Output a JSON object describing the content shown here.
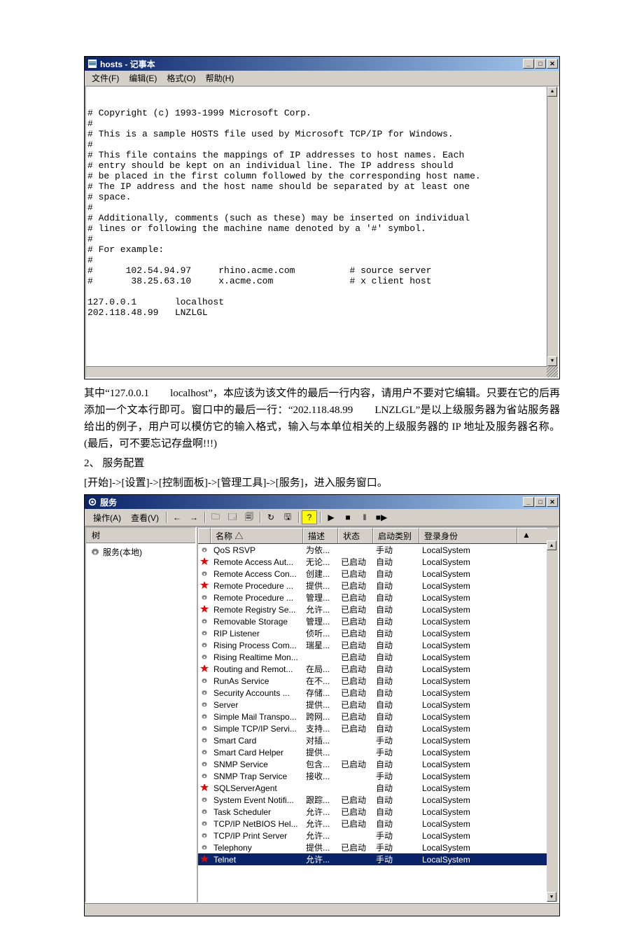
{
  "notepad": {
    "title": "hosts - 记事本",
    "menus": {
      "file": "文件(F)",
      "edit": "编辑(E)",
      "format": "格式(O)",
      "help": "帮助(H)"
    },
    "text": "# Copyright (c) 1993-1999 Microsoft Corp.\n#\n# This is a sample HOSTS file used by Microsoft TCP/IP for Windows.\n#\n# This file contains the mappings of IP addresses to host names. Each\n# entry should be kept on an individual line. The IP address should\n# be placed in the first column followed by the corresponding host name.\n# The IP address and the host name should be separated by at least one\n# space.\n#\n# Additionally, comments (such as these) may be inserted on individual\n# lines or following the machine name denoted by a '#' symbol.\n#\n# For example:\n#\n#      102.54.94.97     rhino.acme.com          # source server\n#       38.25.63.10     x.acme.com              # x client host\n\n127.0.0.1       localhost\n202.118.48.99   LNZLGL\n"
  },
  "explain": {
    "p1": "其中“127.0.0.1　　localhost”，本应该为该文件的最后一行内容，请用户不要对它编辑。只要在它的后再添加一个文本行即可。窗口中的最后一行：“202.118.48.99　　LNZLGL”是以上级服务器为省站服务器给出的例子，用户可以模仿它的输入格式，输入与本单位相关的上级服务器的 IP 地址及服务器名称。(最后，可不要忘记存盘啊!!!)",
    "p2": "2、 服务配置",
    "p3": "[开始]->[设置]->[控制面板]->[管理工具]->[服务]，进入服务窗口。"
  },
  "services": {
    "title": "服务",
    "toolbar": {
      "action": "操作(A)",
      "view": "查看(V)"
    },
    "tree_tab": "树",
    "tree_node": "服务(本地)",
    "headers": {
      "name": "名称  △",
      "desc": "描述",
      "status": "状态",
      "type": "启动类别",
      "logon": "登录身份"
    },
    "rows": [
      {
        "star": false,
        "name": "QoS RSVP",
        "desc": "为依...",
        "status": "",
        "type": "手动",
        "logon": "LocalSystem",
        "sel": false
      },
      {
        "star": true,
        "name": "Remote Access Aut...",
        "desc": "无论...",
        "status": "已启动",
        "type": "自动",
        "logon": "LocalSystem",
        "sel": false
      },
      {
        "star": false,
        "name": "Remote Access Con...",
        "desc": "创建...",
        "status": "已启动",
        "type": "自动",
        "logon": "LocalSystem",
        "sel": false
      },
      {
        "star": true,
        "name": "Remote Procedure ...",
        "desc": "提供...",
        "status": "已启动",
        "type": "自动",
        "logon": "LocalSystem",
        "sel": false
      },
      {
        "star": false,
        "name": "Remote Procedure ...",
        "desc": "管理...",
        "status": "已启动",
        "type": "自动",
        "logon": "LocalSystem",
        "sel": false
      },
      {
        "star": true,
        "name": "Remote Registry Se...",
        "desc": "允许...",
        "status": "已启动",
        "type": "自动",
        "logon": "LocalSystem",
        "sel": false
      },
      {
        "star": false,
        "name": "Removable Storage",
        "desc": "管理...",
        "status": "已启动",
        "type": "自动",
        "logon": "LocalSystem",
        "sel": false
      },
      {
        "star": false,
        "name": "RIP Listener",
        "desc": "侦听...",
        "status": "已启动",
        "type": "自动",
        "logon": "LocalSystem",
        "sel": false
      },
      {
        "star": false,
        "name": "Rising Process Com...",
        "desc": "瑞星...",
        "status": "已启动",
        "type": "自动",
        "logon": "LocalSystem",
        "sel": false
      },
      {
        "star": false,
        "name": "Rising Realtime Mon...",
        "desc": "",
        "status": "已启动",
        "type": "自动",
        "logon": "LocalSystem",
        "sel": false
      },
      {
        "star": true,
        "name": "Routing and Remot...",
        "desc": "在局...",
        "status": "已启动",
        "type": "自动",
        "logon": "LocalSystem",
        "sel": false
      },
      {
        "star": false,
        "name": "RunAs Service",
        "desc": "在不...",
        "status": "已启动",
        "type": "自动",
        "logon": "LocalSystem",
        "sel": false
      },
      {
        "star": false,
        "name": "Security Accounts ...",
        "desc": "存储...",
        "status": "已启动",
        "type": "自动",
        "logon": "LocalSystem",
        "sel": false
      },
      {
        "star": false,
        "name": "Server",
        "desc": "提供...",
        "status": "已启动",
        "type": "自动",
        "logon": "LocalSystem",
        "sel": false
      },
      {
        "star": false,
        "name": "Simple Mail Transpo...",
        "desc": "跨网...",
        "status": "已启动",
        "type": "自动",
        "logon": "LocalSystem",
        "sel": false
      },
      {
        "star": false,
        "name": "Simple TCP/IP Servi...",
        "desc": "支持...",
        "status": "已启动",
        "type": "自动",
        "logon": "LocalSystem",
        "sel": false
      },
      {
        "star": false,
        "name": "Smart Card",
        "desc": "对插...",
        "status": "",
        "type": "手动",
        "logon": "LocalSystem",
        "sel": false
      },
      {
        "star": false,
        "name": "Smart Card Helper",
        "desc": "提供...",
        "status": "",
        "type": "手动",
        "logon": "LocalSystem",
        "sel": false
      },
      {
        "star": false,
        "name": "SNMP Service",
        "desc": "包含...",
        "status": "已启动",
        "type": "自动",
        "logon": "LocalSystem",
        "sel": false
      },
      {
        "star": false,
        "name": "SNMP Trap Service",
        "desc": "接收...",
        "status": "",
        "type": "手动",
        "logon": "LocalSystem",
        "sel": false
      },
      {
        "star": true,
        "name": "SQLServerAgent",
        "desc": "",
        "status": "",
        "type": "自动",
        "logon": "LocalSystem",
        "sel": false
      },
      {
        "star": false,
        "name": "System Event Notifi...",
        "desc": "跟踪...",
        "status": "已启动",
        "type": "自动",
        "logon": "LocalSystem",
        "sel": false
      },
      {
        "star": false,
        "name": "Task Scheduler",
        "desc": "允许...",
        "status": "已启动",
        "type": "自动",
        "logon": "LocalSystem",
        "sel": false
      },
      {
        "star": false,
        "name": "TCP/IP NetBIOS Hel...",
        "desc": "允许...",
        "status": "已启动",
        "type": "自动",
        "logon": "LocalSystem",
        "sel": false
      },
      {
        "star": false,
        "name": "TCP/IP Print Server",
        "desc": "允许...",
        "status": "",
        "type": "手动",
        "logon": "LocalSystem",
        "sel": false
      },
      {
        "star": false,
        "name": "Telephony",
        "desc": "提供...",
        "status": "已启动",
        "type": "手动",
        "logon": "LocalSystem",
        "sel": false
      },
      {
        "star": true,
        "name": "Telnet",
        "desc": "允许...",
        "status": "",
        "type": "手动",
        "logon": "LocalSystem",
        "sel": true
      }
    ]
  }
}
